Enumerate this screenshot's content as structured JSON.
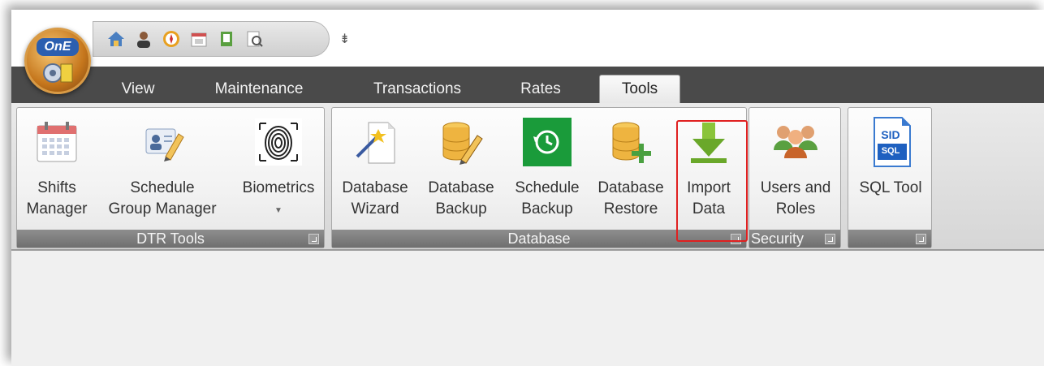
{
  "app": {
    "logo_text": "OnE"
  },
  "qat": {
    "icons": [
      "home-icon",
      "user-icon",
      "compass-icon",
      "calendar-icon",
      "notebook-icon",
      "report-icon"
    ],
    "customize_glyph": "⇟"
  },
  "tabs": [
    {
      "label": "View",
      "active": false
    },
    {
      "label": "Maintenance",
      "active": false
    },
    {
      "label": "Transactions",
      "active": false
    },
    {
      "label": "Rates",
      "active": false
    },
    {
      "label": "Tools",
      "active": true
    }
  ],
  "groups": {
    "dtr_tools": {
      "title": "DTR Tools",
      "buttons": [
        {
          "label1": "Shifts",
          "label2": "Manager",
          "icon": "calendar-icon"
        },
        {
          "label1": "Schedule",
          "label2": "Group Manager",
          "icon": "user-card-edit-icon"
        },
        {
          "label1": "Biometrics",
          "label2": "",
          "icon": "fingerprint-icon"
        }
      ]
    },
    "database": {
      "title": "Database",
      "buttons": [
        {
          "label1": "Database",
          "label2": "Wizard",
          "icon": "wizard-wand-icon"
        },
        {
          "label1": "Database",
          "label2": "Backup",
          "icon": "database-edit-icon"
        },
        {
          "label1": "Schedule",
          "label2": "Backup",
          "icon": "clock-history-icon"
        },
        {
          "label1": "Database",
          "label2": "Restore",
          "icon": "database-add-icon"
        },
        {
          "label1": "Import",
          "label2": "Data",
          "icon": "download-arrow-icon"
        }
      ]
    },
    "security": {
      "title": "Security",
      "buttons": [
        {
          "label1": "Users and",
          "label2": "Roles",
          "icon": "users-group-icon"
        }
      ]
    },
    "sql": {
      "title": "",
      "buttons": [
        {
          "label1": "SQL Tool",
          "label2": "",
          "icon": "sql-tool-icon",
          "icon_text_top": "SID",
          "icon_text_bottom": "SQL"
        }
      ]
    }
  },
  "colors": {
    "tabstrip": "#4a4a4a",
    "group_footer": "#7f7f7f",
    "highlight_border": "#e02020",
    "schedule_backup_tile": "#1a9b3a"
  }
}
